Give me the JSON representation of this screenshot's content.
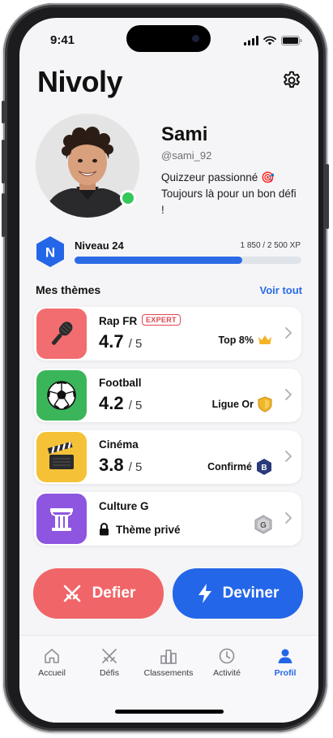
{
  "status_bar": {
    "time": "9:41"
  },
  "header": {
    "title": "Nivoly"
  },
  "profile": {
    "name": "Sami",
    "handle": "@sami_92",
    "bio": "Quizzeur passionné 🎯 Toujours là pour un bon défi !",
    "online": true
  },
  "level": {
    "badge_letter": "N",
    "label": "Niveau 24",
    "xp_text": "1 850 / 2 500 XP",
    "xp_progress": 0.74
  },
  "themes": {
    "title": "Mes thèmes",
    "see_all": "Voir tout",
    "items": [
      {
        "name": "Rap FR",
        "tag": "EXPERT",
        "score": "4.7",
        "out_of": "/ 5",
        "rank": "Top 8%",
        "rank_icon": "crown-icon",
        "icon": "microphone-icon",
        "color": "#f26d6f"
      },
      {
        "name": "Football",
        "score": "4.2",
        "out_of": "/ 5",
        "rank": "Ligue Or",
        "rank_icon": "gold-shield-icon",
        "icon": "soccer-ball-icon",
        "color": "#3bb55a"
      },
      {
        "name": "Cinéma",
        "score": "3.8",
        "out_of": "/ 5",
        "rank": "Confirmé",
        "rank_badge": "B",
        "rank_icon": "hexagon-badge-icon",
        "icon": "clapperboard-icon",
        "color": "#f5c136"
      },
      {
        "name": "Culture G",
        "private_label": "Thème privé",
        "rank_badge": "G",
        "rank_icon": "grey-hexagon-icon",
        "icon": "pillar-icon",
        "color": "#8d55e0"
      }
    ]
  },
  "actions": {
    "defy": "Defier",
    "guess": "Deviner"
  },
  "tabbar": {
    "items": [
      {
        "label": "Accueil",
        "icon": "home-icon"
      },
      {
        "label": "Défis",
        "icon": "crossed-swords-icon"
      },
      {
        "label": "Classements",
        "icon": "podium-icon"
      },
      {
        "label": "Activité",
        "icon": "clock-icon"
      },
      {
        "label": "Profil",
        "icon": "person-icon",
        "active": true
      }
    ]
  },
  "colors": {
    "accent": "#2466e8",
    "defy": "#f06568",
    "online": "#34c759"
  }
}
